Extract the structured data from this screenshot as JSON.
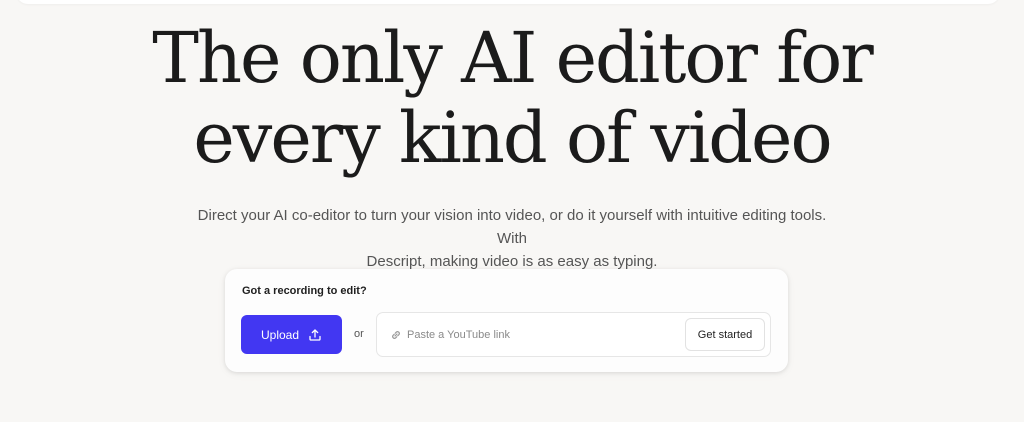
{
  "hero": {
    "headline_line1": "The only AI editor for",
    "headline_line2": "every kind of video",
    "subtitle_line1": "Direct your AI co-editor to turn your vision into video, or do it yourself with intuitive editing tools. With",
    "subtitle_line2": "Descript, making video is as easy as typing."
  },
  "card": {
    "title": "Got a recording to edit?",
    "upload_label": "Upload",
    "upload_icon": "upload-icon",
    "or_text": "or",
    "link_icon": "link-icon",
    "link_placeholder": "Paste a YouTube link",
    "link_value": "",
    "get_started_label": "Get started"
  },
  "colors": {
    "background": "#f8f7f5",
    "accent": "#4237f2",
    "headline": "#1b1b1b",
    "subtitle": "#555555"
  }
}
